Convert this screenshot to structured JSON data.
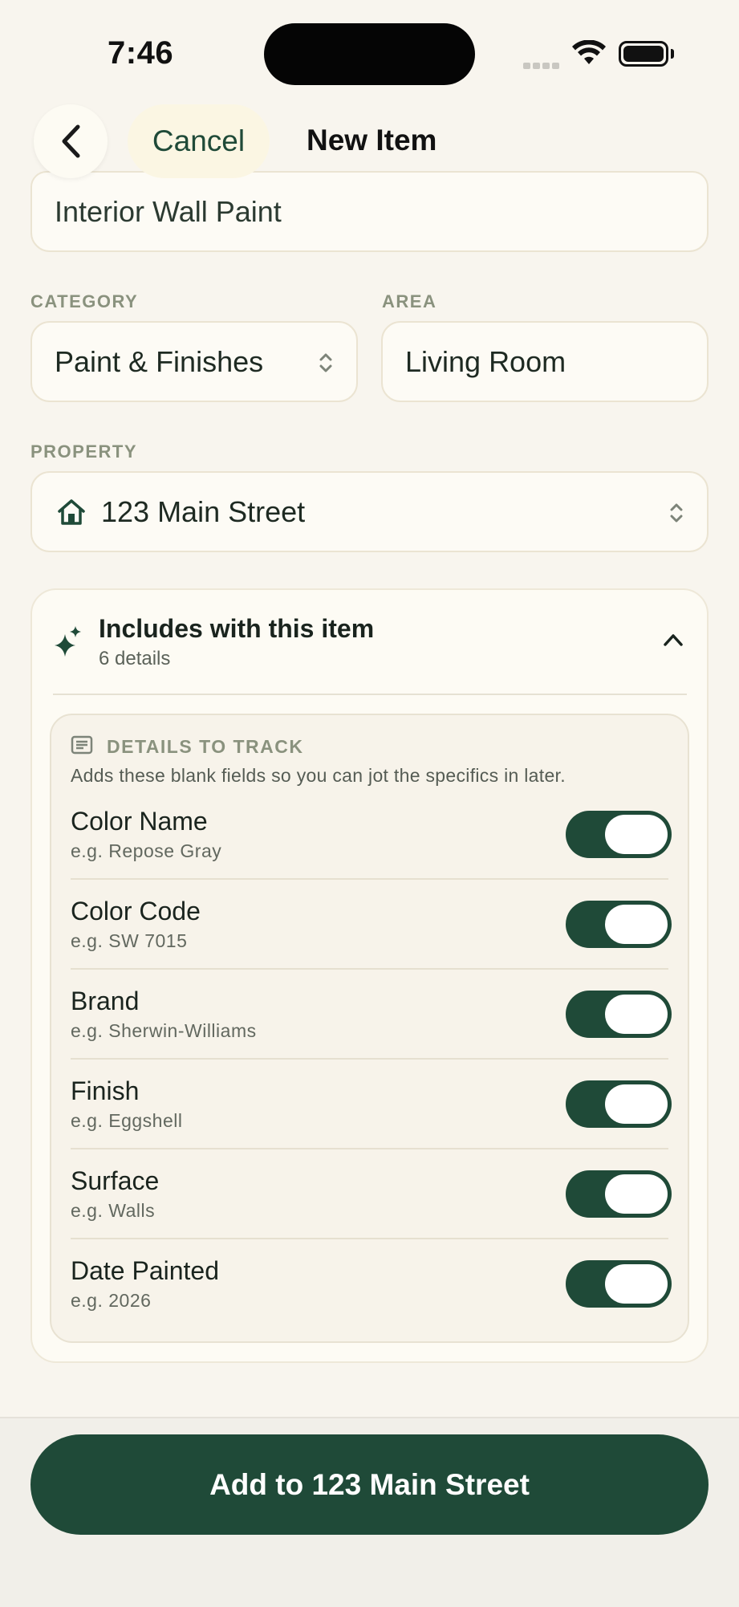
{
  "status_bar": {
    "time": "7:46"
  },
  "nav": {
    "cancel_label": "Cancel",
    "title": "New Item"
  },
  "form": {
    "item_name_value": "Interior Wall Paint",
    "category_label": "CATEGORY",
    "category_value": "Paint & Finishes",
    "area_label": "AREA",
    "area_value": "Living Room",
    "property_label": "PROPERTY",
    "property_value": "123 Main Street"
  },
  "includes": {
    "title": "Includes with this item",
    "subtitle": "6 details",
    "section_label": "DETAILS TO TRACK",
    "description": "Adds these blank fields so you can jot the specifics in later.",
    "items": [
      {
        "name": "Color Name",
        "hint": "e.g. Repose Gray",
        "enabled": true
      },
      {
        "name": "Color Code",
        "hint": "e.g. SW 7015",
        "enabled": true
      },
      {
        "name": "Brand",
        "hint": "e.g. Sherwin-Williams",
        "enabled": true
      },
      {
        "name": "Finish",
        "hint": "e.g. Eggshell",
        "enabled": true
      },
      {
        "name": "Surface",
        "hint": "e.g. Walls",
        "enabled": true
      },
      {
        "name": "Date Painted",
        "hint": "e.g. 2026",
        "enabled": true
      }
    ]
  },
  "footer": {
    "add_button_label": "Add to 123 Main Street"
  },
  "colors": {
    "accent": "#1f4a38",
    "background": "#f8f5ee",
    "card": "#fdfbf4"
  }
}
